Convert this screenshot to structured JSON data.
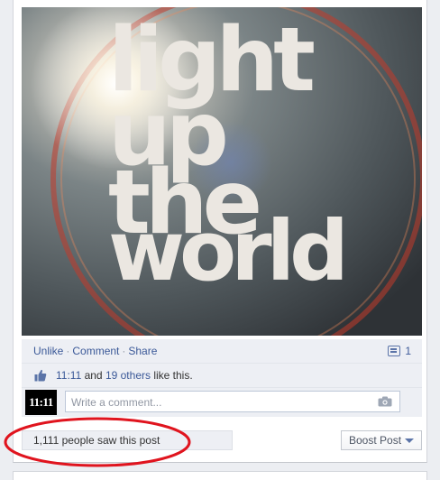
{
  "photo": {
    "words": [
      "light",
      "up",
      "the",
      "world"
    ]
  },
  "actions": {
    "unlike": "Unlike",
    "comment": "Comment",
    "share": "Share",
    "separator": "·",
    "share_count": "1",
    "share_icon": "share-count-icon"
  },
  "likes": {
    "icon": "thumbs-up-icon",
    "name": "11:11",
    "and_text": " and ",
    "others": "19 others",
    "suffix": " like this."
  },
  "comment_box": {
    "avatar_text": "11:11",
    "placeholder": "Write a comment...",
    "camera_icon": "camera-icon"
  },
  "reach": {
    "text": "1,111 people saw this post"
  },
  "boost": {
    "label": "Boost Post",
    "icon": "chevron-down-icon"
  },
  "colors": {
    "link": "#3b5998",
    "annotation": "#e0141e",
    "panel": "#edeff4"
  }
}
